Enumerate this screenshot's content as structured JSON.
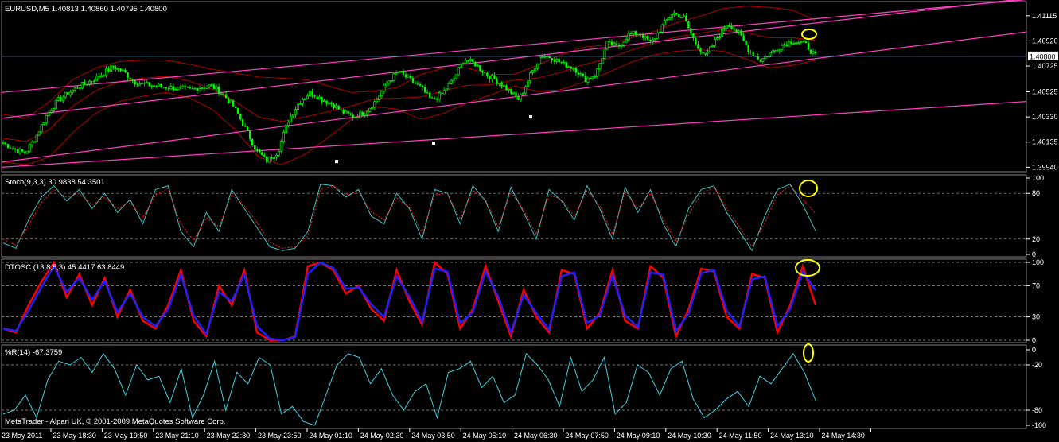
{
  "window": {
    "symbol_header": "EURUSD,M5  1.40813 1.40860 1.40795 1.40800",
    "watermark": "MetaTrader - Alpari UK, © 2001-2009 MetaQuotes Software Corp."
  },
  "colors": {
    "background": "#000000",
    "bull_candle": "#00ff00",
    "bear_candle": "#00ff00",
    "bollinger": "#c00000",
    "trendline": "#ff40c0",
    "stoch_main": "#40c0c0",
    "stoch_signal": "#ff2020",
    "dtosc_fast": "#ff0000",
    "dtosc_slow": "#2020ff",
    "williams": "#40d0e0",
    "highlight": "#ffff00",
    "level_line": "#a0a0a0"
  },
  "chart_data": [
    {
      "type": "candlestick",
      "title": "EURUSD,M5  1.40813 1.40860 1.40795 1.40800",
      "symbol": "EURUSD",
      "timeframe": "M5",
      "last_ohlc": {
        "open": 1.40813,
        "high": 1.4086,
        "low": 1.40795,
        "close": 1.408
      },
      "current_price_label": "1.40800",
      "current_price": 1.408,
      "yticks": [
        "1.41115",
        "1.40920",
        "1.40725",
        "1.40525",
        "1.40330",
        "1.40135",
        "1.39940"
      ],
      "ylim": [
        1.3993,
        1.412
      ],
      "price_path": [
        1.4013,
        1.4008,
        1.4005,
        1.4018,
        1.4035,
        1.4046,
        1.4052,
        1.4057,
        1.4061,
        1.4066,
        1.4072,
        1.4068,
        1.406,
        1.4058,
        1.4057,
        1.4056,
        1.4055,
        1.4054,
        1.4056,
        1.4057,
        1.4051,
        1.4041,
        1.4025,
        1.4008,
        1.3999,
        1.4006,
        1.4031,
        1.4045,
        1.4052,
        1.4047,
        1.4043,
        1.4036,
        1.4033,
        1.4037,
        1.4046,
        1.406,
        1.4068,
        1.4062,
        1.4056,
        1.4046,
        1.4051,
        1.4062,
        1.4078,
        1.4074,
        1.4066,
        1.4061,
        1.4054,
        1.4046,
        1.4065,
        1.4081,
        1.4079,
        1.4074,
        1.4071,
        1.4062,
        1.4066,
        1.409,
        1.4087,
        1.4097,
        1.4098,
        1.409,
        1.4103,
        1.4114,
        1.411,
        1.4091,
        1.408,
        1.4094,
        1.4106,
        1.4098,
        1.4084,
        1.4077,
        1.4083,
        1.4089,
        1.4092,
        1.409,
        1.408
      ],
      "bands_upper": [
        1.4035,
        1.4032,
        1.4045,
        1.4062,
        1.4071,
        1.4076,
        1.4077,
        1.4077,
        1.4074,
        1.407,
        1.4067,
        1.4064,
        1.4063,
        1.4062,
        1.4057,
        1.4052,
        1.4053,
        1.4056,
        1.4066,
        1.4071,
        1.4071,
        1.4066,
        1.4066,
        1.4073,
        1.4081,
        1.4087,
        1.4089,
        1.4094,
        1.4099,
        1.4106,
        1.4111,
        1.4117,
        1.4119,
        1.4118,
        1.4116,
        1.4108
      ],
      "bands_lower": [
        1.3998,
        1.3996,
        1.4002,
        1.4021,
        1.4036,
        1.4045,
        1.4049,
        1.4052,
        1.4048,
        1.4039,
        1.4023,
        1.4002,
        1.3996,
        1.4004,
        1.4017,
        1.4031,
        1.4041,
        1.4039,
        1.4031,
        1.4036,
        1.4044,
        1.405,
        1.4057,
        1.4053,
        1.4054,
        1.406,
        1.4067,
        1.4075,
        1.4081,
        1.4084,
        1.4085,
        1.4084,
        1.4078,
        1.4071,
        1.4073,
        1.4077
      ],
      "trendlines": [
        {
          "from": {
            "bar": 0,
            "price": 1.4052
          },
          "to": {
            "bar": 1,
            "price": 1.4124
          }
        },
        {
          "from": {
            "bar": 0,
            "price": 1.4032
          },
          "to": {
            "bar": 1,
            "price": 1.4125
          }
        },
        {
          "from": {
            "bar": 0,
            "price": 1.3994
          },
          "to": {
            "bar": 1,
            "price": 1.4045
          }
        },
        {
          "from": {
            "bar": 0,
            "price": 1.3998
          },
          "to": {
            "bar": 1,
            "price": 1.4099
          }
        }
      ]
    },
    {
      "type": "line",
      "title": "Stoch(9,3,3) 30.9838 54.3501",
      "ylim": [
        0,
        100
      ],
      "levels": [
        80,
        20
      ],
      "yticks": [
        "100",
        "80",
        "20",
        "0"
      ],
      "series": [
        {
          "name": "main",
          "values": [
            15,
            8,
            45,
            75,
            90,
            70,
            85,
            60,
            80,
            55,
            72,
            40,
            85,
            90,
            30,
            10,
            55,
            30,
            85,
            60,
            35,
            10,
            5,
            8,
            30,
            92,
            90,
            75,
            85,
            50,
            40,
            80,
            60,
            20,
            85,
            80,
            40,
            90,
            70,
            30,
            88,
            55,
            20,
            85,
            70,
            45,
            90,
            60,
            20,
            88,
            55,
            85,
            40,
            10,
            60,
            85,
            90,
            55,
            30,
            5,
            50,
            85,
            92,
            65,
            31
          ]
        },
        {
          "name": "signal",
          "values": [
            20,
            12,
            38,
            68,
            85,
            75,
            80,
            65,
            75,
            60,
            68,
            48,
            78,
            86,
            40,
            18,
            48,
            36,
            78,
            64,
            42,
            16,
            8,
            10,
            24,
            85,
            90,
            78,
            82,
            56,
            45,
            74,
            62,
            28,
            78,
            80,
            46,
            84,
            72,
            36,
            82,
            58,
            26,
            78,
            72,
            50,
            84,
            64,
            26,
            82,
            60,
            80,
            46,
            16,
            52,
            80,
            88,
            60,
            36,
            10,
            42,
            78,
            90,
            72,
            54
          ]
        }
      ]
    },
    {
      "type": "line",
      "title": "DTOSC (13,8,5,3) 45.4417 63.8449",
      "ylim": [
        0,
        100
      ],
      "levels": [
        100,
        70,
        30,
        0
      ],
      "yticks": [
        "100",
        "70",
        "30",
        "0"
      ],
      "series": [
        {
          "name": "fast",
          "values": [
            15,
            10,
            45,
            75,
            100,
            55,
            85,
            45,
            80,
            30,
            65,
            25,
            15,
            45,
            90,
            25,
            5,
            70,
            45,
            90,
            10,
            0,
            0,
            5,
            95,
            100,
            90,
            60,
            70,
            40,
            25,
            90,
            50,
            20,
            100,
            85,
            15,
            40,
            95,
            50,
            5,
            65,
            30,
            10,
            90,
            85,
            15,
            35,
            90,
            25,
            15,
            95,
            80,
            5,
            40,
            92,
            88,
            30,
            15,
            85,
            80,
            10,
            45,
            95,
            45
          ]
        },
        {
          "name": "slow",
          "values": [
            15,
            12,
            38,
            68,
            95,
            62,
            80,
            52,
            76,
            36,
            60,
            30,
            18,
            40,
            84,
            32,
            8,
            62,
            50,
            84,
            18,
            2,
            0,
            4,
            85,
            100,
            93,
            66,
            68,
            46,
            30,
            82,
            56,
            24,
            92,
            88,
            22,
            36,
            88,
            56,
            10,
            58,
            35,
            14,
            82,
            87,
            22,
            32,
            83,
            32,
            17,
            87,
            84,
            12,
            34,
            86,
            90,
            38,
            18,
            78,
            82,
            18,
            40,
            88,
            64
          ]
        }
      ]
    },
    {
      "type": "line",
      "title": "%R(14) -67.3759",
      "ylim": [
        -100,
        0
      ],
      "levels": [
        -20,
        -80
      ],
      "yticks": [
        "0",
        "-20",
        "-80",
        "-100"
      ],
      "series": [
        {
          "name": "%R",
          "values": [
            -85,
            -80,
            -60,
            -90,
            -40,
            -15,
            -20,
            -10,
            -30,
            -5,
            -25,
            -60,
            -20,
            -40,
            -35,
            -70,
            -25,
            -90,
            -60,
            -15,
            -80,
            -30,
            -45,
            -10,
            -20,
            -85,
            -75,
            -95,
            -100,
            -60,
            -20,
            -5,
            -10,
            -45,
            -25,
            -60,
            -80,
            -55,
            -45,
            -90,
            -30,
            -25,
            -15,
            -50,
            -35,
            -70,
            -60,
            -5,
            -20,
            -40,
            -75,
            -10,
            -55,
            -40,
            -10,
            -85,
            -70,
            -20,
            -30,
            -60,
            -25,
            -15,
            -65,
            -90,
            -80,
            -65,
            -55,
            -75,
            -35,
            -45,
            -25,
            -5,
            -30,
            -67
          ]
        }
      ]
    }
  ],
  "time_axis": [
    "23 May 2011",
    "23 May 18:30",
    "23 May 19:50",
    "23 May 21:10",
    "23 May 22:30",
    "23 May 23:50",
    "24 May 01:10",
    "24 May 02:30",
    "24 May 03:50",
    "24 May 05:10",
    "24 May 06:30",
    "24 May 07:50",
    "24 May 09:10",
    "24 May 10:30",
    "24 May 11:50",
    "24 May 13:10",
    "24 May 14:30"
  ]
}
